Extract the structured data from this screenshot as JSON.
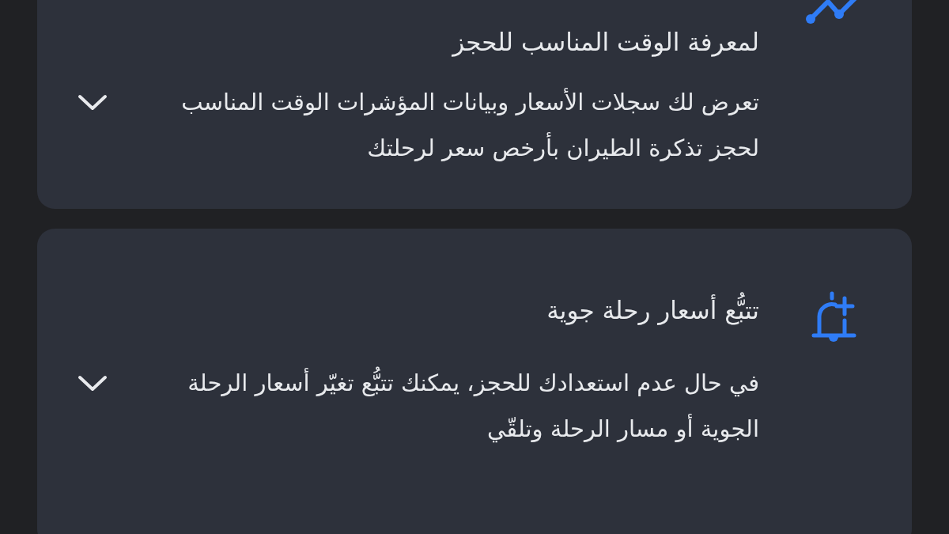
{
  "cards": [
    {
      "kind": "history",
      "title": "لمعرفة الوقت المناسب للحجز",
      "body": "تعرض لك سجلات الأسعار وبيانات المؤشرات الوقت المناسب لحجز تذكرة الطيران بأرخص سعر لرحلتك"
    },
    {
      "kind": "track",
      "title": "تتبُّع أسعار رحلة جوية",
      "body": "في حال عدم استعدادك للحجز، يمكنك تتبُّع تغيّر أسعار الرحلة الجوية أو مسار الرحلة وتلقّي"
    }
  ]
}
